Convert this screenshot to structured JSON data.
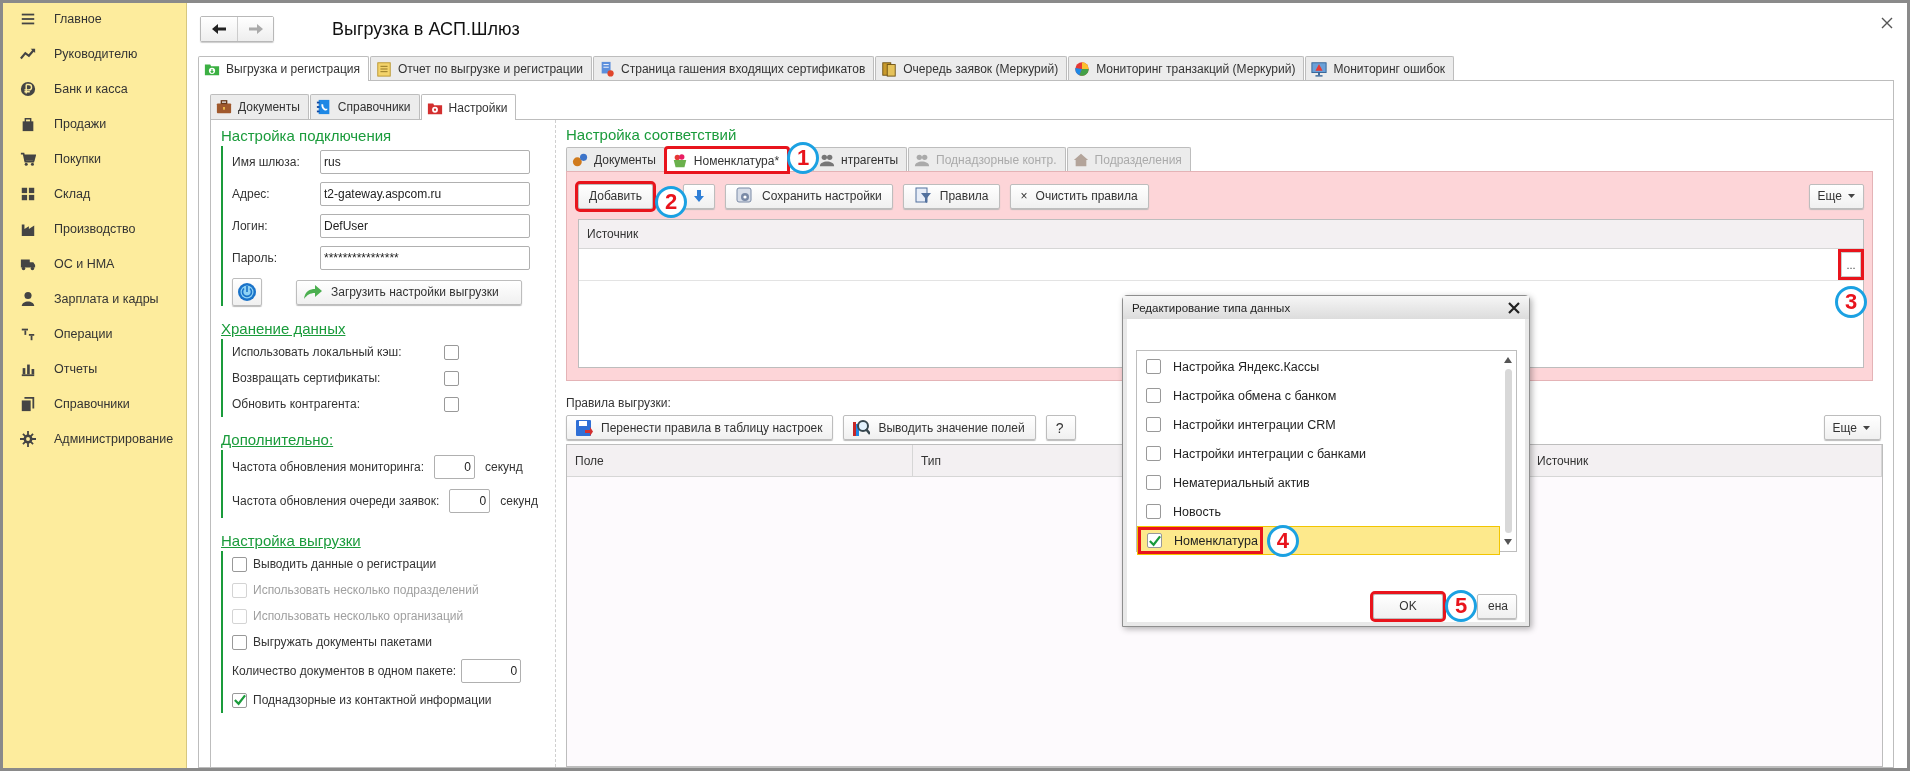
{
  "sidebar": {
    "items": [
      {
        "label": "Главное"
      },
      {
        "label": "Руководителю"
      },
      {
        "label": "Банк и касса"
      },
      {
        "label": "Продажи"
      },
      {
        "label": "Покупки"
      },
      {
        "label": "Склад"
      },
      {
        "label": "Производство"
      },
      {
        "label": "ОС и НМА"
      },
      {
        "label": "Зарплата и кадры"
      },
      {
        "label": "Операции"
      },
      {
        "label": "Отчеты"
      },
      {
        "label": "Справочники"
      },
      {
        "label": "Администрирование"
      }
    ]
  },
  "window": {
    "title": "Выгрузка в АСП.Шлюз"
  },
  "main_tabs": [
    {
      "label": "Выгрузка и регистрация",
      "selected": true
    },
    {
      "label": "Отчет по выгрузке и регистрации",
      "selected": false
    },
    {
      "label": "Страница гашения входящих сертификатов",
      "selected": false
    },
    {
      "label": "Очередь заявок (Меркурий)",
      "selected": false
    },
    {
      "label": "Мониторинг транзакций (Меркурий)",
      "selected": false
    },
    {
      "label": "Мониторинг ошибок",
      "selected": false
    }
  ],
  "sub_tabs": [
    {
      "label": "Документы",
      "selected": false
    },
    {
      "label": "Справочники",
      "selected": false
    },
    {
      "label": "Настройки",
      "selected": true
    }
  ],
  "connection": {
    "title": "Настройка подключения",
    "fields": [
      {
        "label": "Имя шлюза:",
        "value": "rus"
      },
      {
        "label": "Адрес:",
        "value": "t2-gateway.aspcom.ru"
      },
      {
        "label": "Логин:",
        "value": "DefUser"
      },
      {
        "label": "Пароль:",
        "value": "****************"
      }
    ],
    "load_button": "Загрузить настройки выгрузки"
  },
  "storage": {
    "title": "Хранение данных",
    "options": [
      {
        "label": "Использовать локальный кэш:",
        "checked": false
      },
      {
        "label": "Возвращать сертификаты:",
        "checked": false
      },
      {
        "label": "Обновить контрагента:",
        "checked": false
      }
    ]
  },
  "additional": {
    "title": "Дополнительно:",
    "rows": [
      {
        "label": "Частота обновления мониторинга:",
        "value": "0",
        "unit": "секунд"
      },
      {
        "label": "Частота обновления очереди заявок:",
        "value": "0",
        "unit": "секунд"
      }
    ]
  },
  "export_settings": {
    "title": "Настройка выгрузки",
    "items": [
      {
        "kind": "checkbox",
        "label": "Выводить данные о регистрации",
        "checked": false,
        "disabled": false
      },
      {
        "kind": "checkbox",
        "label": "Использовать несколько подразделений",
        "checked": false,
        "disabled": true
      },
      {
        "kind": "checkbox",
        "label": "Использовать несколько организаций",
        "checked": false,
        "disabled": true
      },
      {
        "kind": "checkbox",
        "label": "Выгружать документы пакетами",
        "checked": false,
        "disabled": false
      },
      {
        "kind": "number",
        "label": "Количество документов в одном пакете:",
        "value": "0"
      },
      {
        "kind": "checkbox",
        "label": "Поднадзорные из контактной информации",
        "checked": true,
        "disabled": false
      }
    ]
  },
  "mapping": {
    "title": "Настройка соответствий",
    "tabs": [
      {
        "label": "Документы",
        "selected": false,
        "disabled": false,
        "highlighted": false
      },
      {
        "label": "Номенклатура*",
        "selected": true,
        "disabled": false,
        "highlighted": true,
        "callout": "1"
      },
      {
        "label": "нтрагенты",
        "selected": false,
        "disabled": false,
        "highlighted": false
      },
      {
        "label": "Поднадзорные контр.",
        "selected": false,
        "disabled": true,
        "highlighted": false
      },
      {
        "label": "Подразделения",
        "selected": false,
        "disabled": true,
        "highlighted": false
      }
    ],
    "add_button": {
      "label": "Добавить",
      "highlighted": true,
      "callout": "2"
    },
    "buttons": [
      {
        "label": "Сохранить настройки"
      },
      {
        "label": "Правила"
      },
      {
        "label": "Очистить правила",
        "glyph": "×"
      }
    ],
    "more": "Еще",
    "table": {
      "columns": [
        "Источник"
      ],
      "rows": [
        {
          "choice_button": "...",
          "highlighted": true,
          "callout": "3"
        }
      ]
    }
  },
  "rules": {
    "title": "Правила выгрузки:",
    "buttons": [
      {
        "label": "Перенести правила в таблицу настроек"
      },
      {
        "label": "Выводить значение полей"
      }
    ],
    "help": "?",
    "more": "Еще",
    "table": {
      "columns": [
        "Поле",
        "Тип",
        "Источник"
      ]
    }
  },
  "dialog": {
    "title": "Редактирование типа данных",
    "items": [
      {
        "label": "Настройка Яндекс.Кассы",
        "checked": false,
        "selected": false,
        "highlighted": false
      },
      {
        "label": "Настройка обмена с банком",
        "checked": false,
        "selected": false,
        "highlighted": false
      },
      {
        "label": "Настройки интеграции CRM",
        "checked": false,
        "selected": false,
        "highlighted": false
      },
      {
        "label": "Настройки интеграции с банками",
        "checked": false,
        "selected": false,
        "highlighted": false
      },
      {
        "label": "Нематериальный актив",
        "checked": false,
        "selected": false,
        "highlighted": false
      },
      {
        "label": "Новость",
        "checked": false,
        "selected": false,
        "highlighted": false
      },
      {
        "label": "Номенклатура",
        "checked": true,
        "selected": true,
        "highlighted": true,
        "callout": "4"
      }
    ],
    "buttons": [
      {
        "label": "OK",
        "highlighted": true,
        "callout": "5"
      },
      {
        "label": "ена",
        "highlighted": false
      }
    ]
  }
}
